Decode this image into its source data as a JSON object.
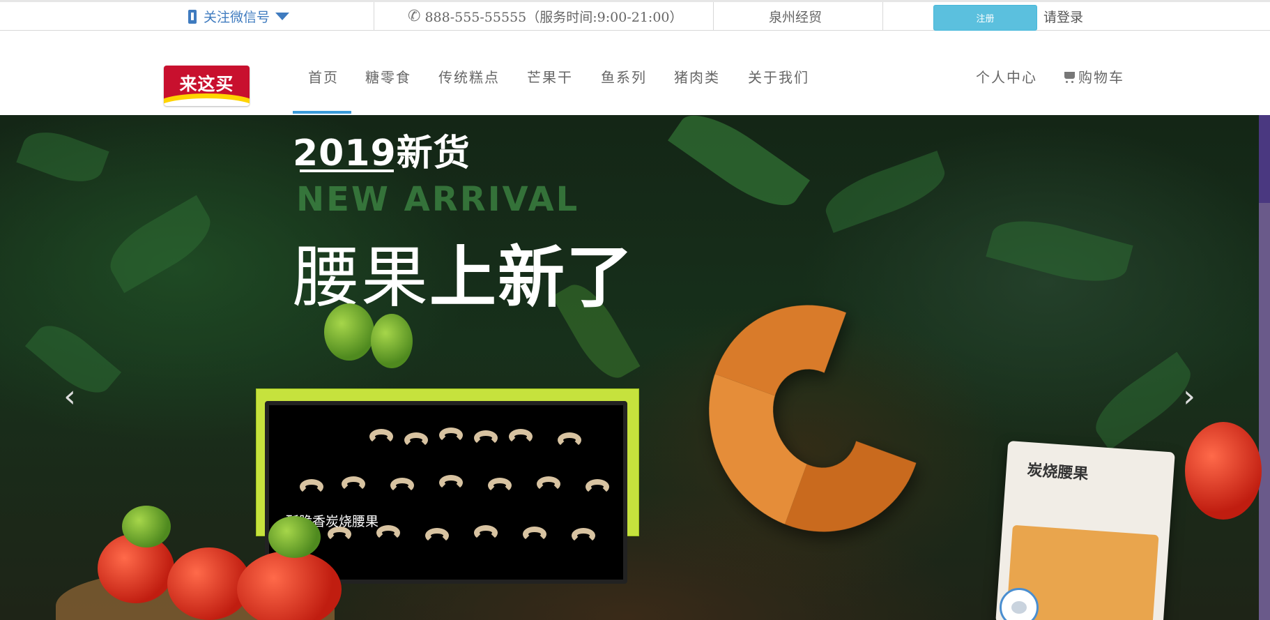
{
  "topbar": {
    "wechat_label": "关注微信号",
    "hotline": "888-555-55555（服务时间:9:00-21:00）",
    "company": "泉州经贸",
    "register_label": "注册",
    "login_label": "请登录"
  },
  "header": {
    "logo_text": "来这买",
    "nav_items": [
      {
        "label": "首页",
        "active": true
      },
      {
        "label": "糖零食"
      },
      {
        "label": "传统糕点"
      },
      {
        "label": "芒果干"
      },
      {
        "label": "鱼系列"
      },
      {
        "label": "猪肉类"
      },
      {
        "label": "关于我们"
      }
    ],
    "personal_center": "个人中心",
    "cart": "购物车"
  },
  "banner": {
    "year_title": "2019新货",
    "english_title": "NEW ARRIVAL",
    "headline_thin": "腰果",
    "headline_bold": "上新了",
    "screen_caption": "酥脆香炭烧腰果",
    "package_title": "炭烧腰果"
  },
  "colors": {
    "accent": "#3a9ad9",
    "register_bg": "#5bc0de",
    "wechat": "#3f7bbf",
    "logo_red": "#c8102e"
  },
  "icons": [
    "phone-icon",
    "caret-down-icon",
    "telephone-icon",
    "cart-icon",
    "chevron-left-icon",
    "chevron-right-icon",
    "chat-icon"
  ]
}
